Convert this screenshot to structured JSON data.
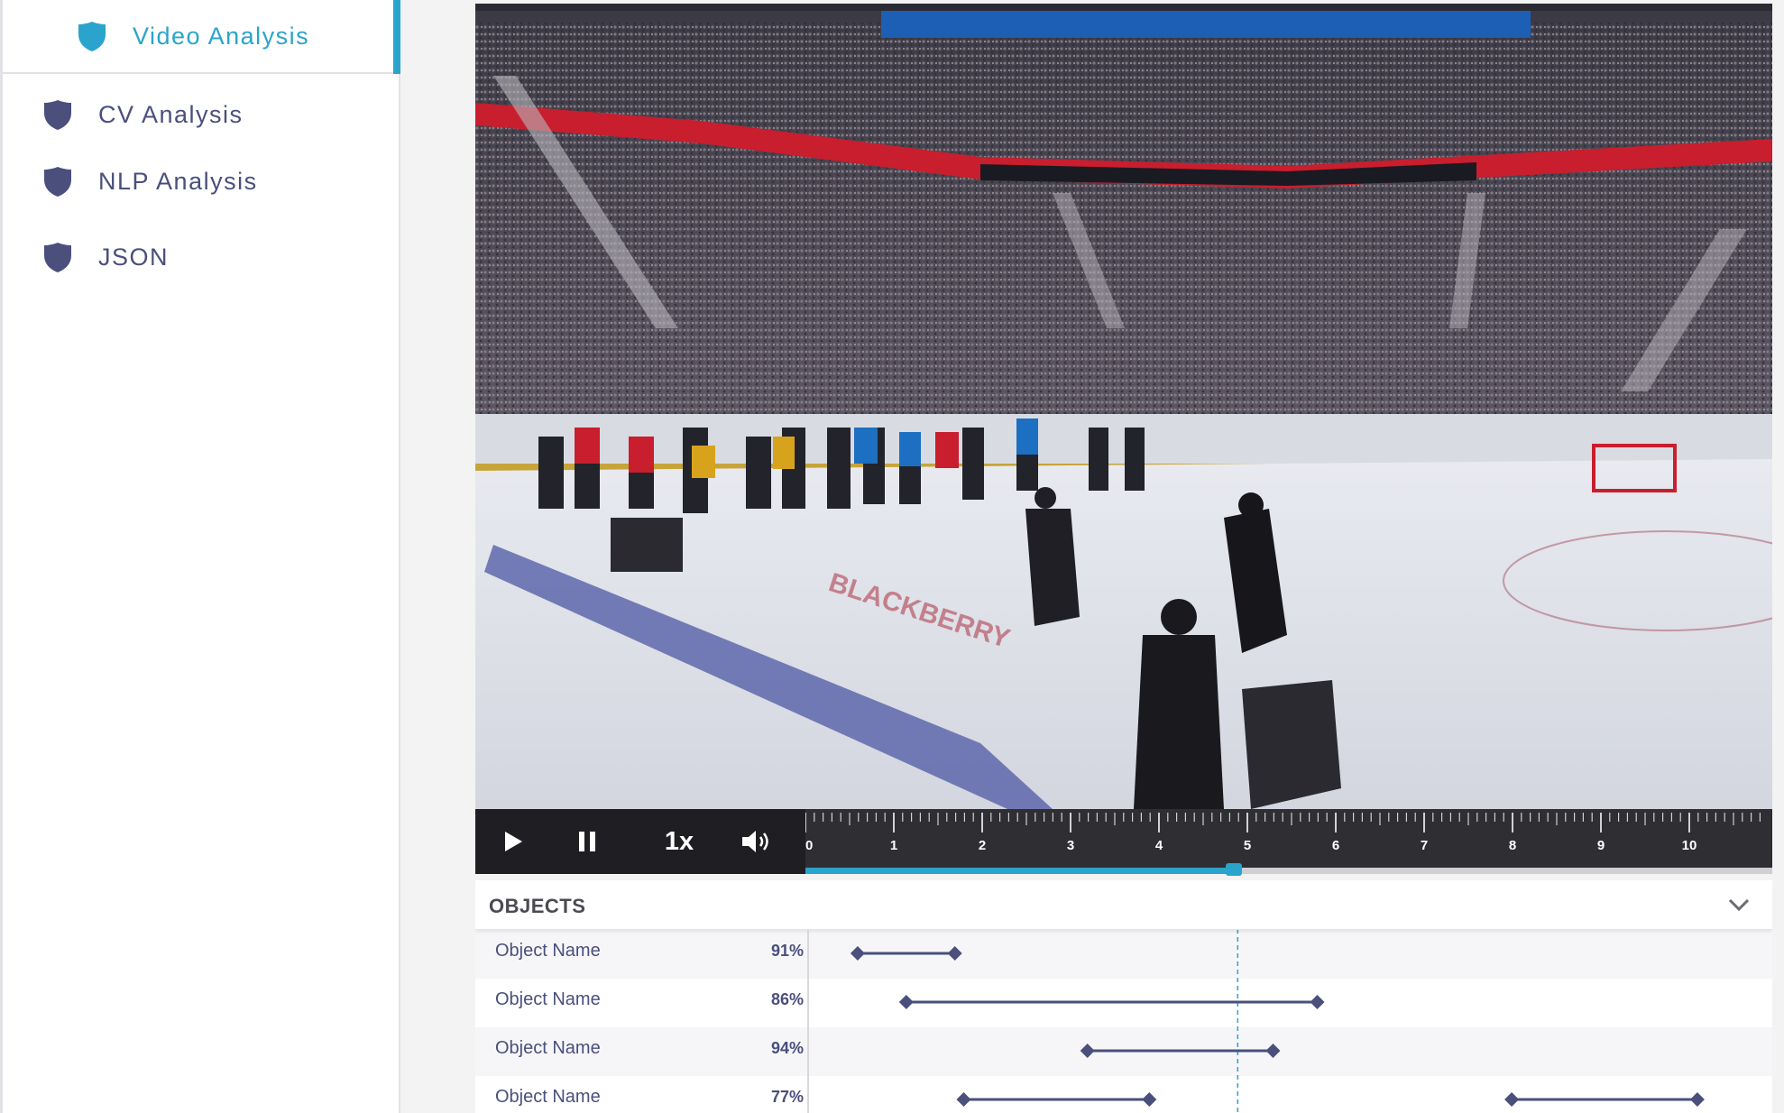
{
  "sidebar": {
    "items": [
      {
        "label": "Video Analysis",
        "active": true
      },
      {
        "label": "CV Analysis",
        "active": false
      },
      {
        "label": "NLP Analysis",
        "active": false
      },
      {
        "label": "JSON",
        "active": false
      }
    ]
  },
  "player": {
    "speed_label": "1x",
    "timeline": {
      "ticks": [
        "0",
        "1",
        "2",
        "3",
        "4",
        "5",
        "6",
        "7",
        "8",
        "9",
        "10"
      ],
      "current_time": 4.85,
      "max_time": 10.9
    }
  },
  "objects": {
    "title": "OBJECTS",
    "rows": [
      {
        "name": "Object Name",
        "confidence": "91%",
        "segments": [
          [
            0.55,
            1.65
          ]
        ]
      },
      {
        "name": "Object Name",
        "confidence": "86%",
        "segments": [
          [
            1.1,
            5.75
          ]
        ]
      },
      {
        "name": "Object Name",
        "confidence": "94%",
        "segments": [
          [
            3.15,
            5.25
          ]
        ]
      },
      {
        "name": "Object Name",
        "confidence": "77%",
        "segments": [
          [
            1.75,
            3.85
          ],
          [
            7.95,
            10.05
          ]
        ]
      }
    ]
  },
  "colors": {
    "accent": "#2aa4cc",
    "nav_text": "#4a4f7c",
    "controls_bg": "#1f1f23",
    "timeline_bg": "#2e2e33",
    "segment": "#4a4f7c"
  }
}
